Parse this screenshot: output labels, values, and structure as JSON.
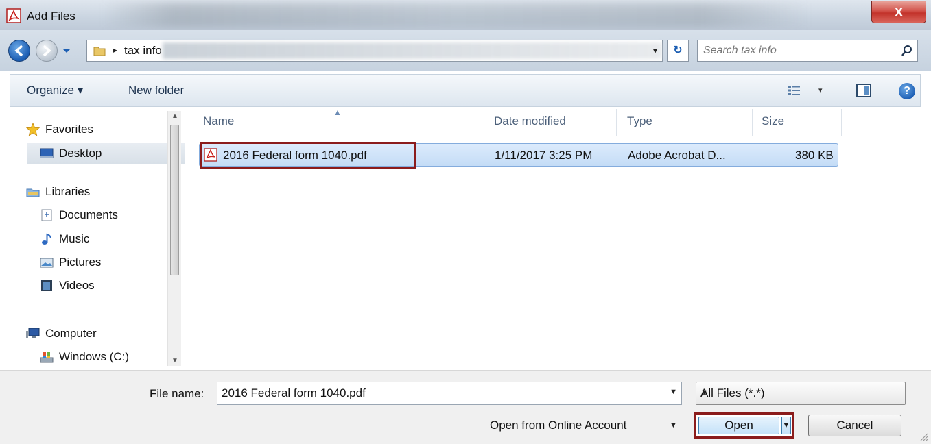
{
  "window": {
    "title": "Add Files",
    "close_glyph": "x",
    "app_icon": "pdf-icon",
    "accent_close": "#c2322a",
    "highlight_outline": "#8b1c1c"
  },
  "address_bar": {
    "breadcrumb": "tax info",
    "breadcrumb_arrow": "▸",
    "search_placeholder": "Search tax info",
    "refresh_glyph": "↻",
    "dropdown_glyph": "▾"
  },
  "toolbar": {
    "organize_label": "Organize ▾",
    "new_folder_label": "New folder",
    "view_drop_glyph": "▾",
    "help_glyph": "?"
  },
  "nav_pane": {
    "favorites": "Favorites",
    "desktop": "Desktop",
    "libraries": "Libraries",
    "documents": "Documents",
    "music": "Music",
    "pictures": "Pictures",
    "videos": "Videos",
    "computer": "Computer",
    "windows_c": "Windows (C:)"
  },
  "file_list": {
    "columns": {
      "name": "Name",
      "date_modified": "Date modified",
      "type": "Type",
      "size": "Size"
    },
    "rows": [
      {
        "name": "2016 Federal form 1040.pdf",
        "date_modified": "1/11/2017 3:25 PM",
        "type": "Adobe Acrobat D...",
        "size": "380 KB"
      }
    ]
  },
  "bottom": {
    "file_name_label": "File name:",
    "file_name_value": "2016 Federal form 1040.pdf",
    "filter_value": "All Files (*.*)",
    "open_from_online": "Open from Online Account",
    "open_label": "Open",
    "cancel_label": "Cancel"
  }
}
